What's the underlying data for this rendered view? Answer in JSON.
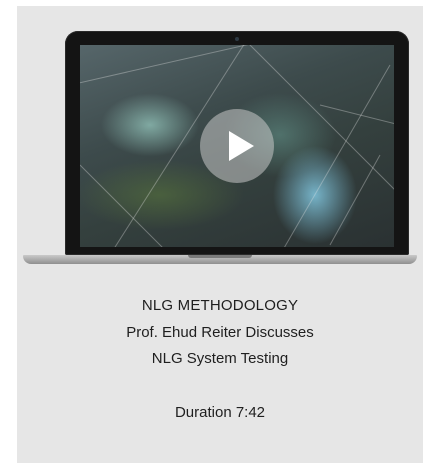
{
  "video": {
    "title": "NLG METHODOLOGY",
    "subtitle_line1": "Prof. Ehud Reiter Discusses",
    "subtitle_line2": "NLG System Testing",
    "duration": "Duration 7:42",
    "play_icon": "play-icon"
  },
  "colors": {
    "card_background": "#e6e6e6",
    "text": "#1f1f1f",
    "play_button": "rgba(200,200,200,0.55)"
  }
}
